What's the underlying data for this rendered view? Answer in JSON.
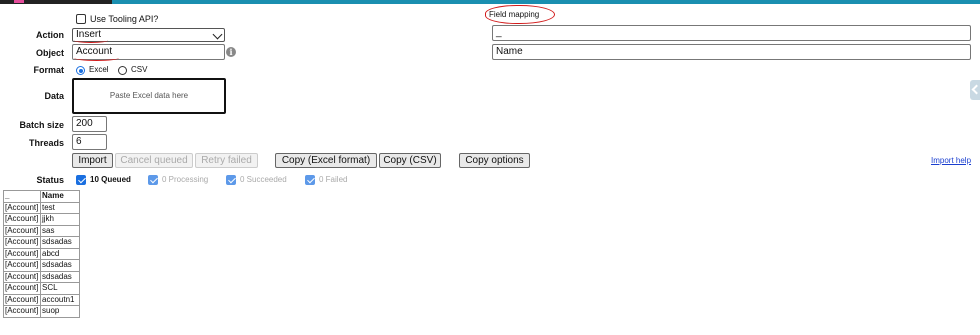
{
  "tooling_api": {
    "label": "Use Tooling API?",
    "checked": false
  },
  "field_mapping": {
    "title": "Field mapping",
    "mapping_1": "_",
    "mapping_2": "Name"
  },
  "form": {
    "action_label": "Action",
    "action_value": "Insert",
    "object_label": "Object",
    "object_value": "Account",
    "info_icon": "i",
    "format_label": "Format",
    "format_options": [
      "Excel",
      "CSV"
    ],
    "format_selected": "Excel",
    "data_label": "Data",
    "data_placeholder": "Paste Excel data here",
    "batch_label": "Batch size",
    "batch_value": "200",
    "threads_label": "Threads",
    "threads_value": "6"
  },
  "buttons": {
    "import": "Import",
    "cancel": "Cancel queued",
    "retry": "Retry failed",
    "copy_excel": "Copy (Excel format)",
    "copy_csv": "Copy (CSV)",
    "copy_options": "Copy options",
    "import_help": "Import help"
  },
  "status": {
    "label": "Status",
    "queued": "10 Queued",
    "processing": "0 Processing",
    "succeeded": "0 Succeeded",
    "failed": "0 Failed"
  },
  "results": {
    "headers": [
      "_",
      "Name"
    ],
    "rows": [
      [
        "[Account]",
        "test"
      ],
      [
        "[Account]",
        "jjkh"
      ],
      [
        "[Account]",
        "sas"
      ],
      [
        "[Account]",
        "sdsadas"
      ],
      [
        "[Account]",
        "abcd"
      ],
      [
        "[Account]",
        "sdsadas"
      ],
      [
        "[Account]",
        "sdsadas"
      ],
      [
        "[Account]",
        "SCL"
      ],
      [
        "[Account]",
        "accoutn1"
      ],
      [
        "[Account]",
        "suop"
      ]
    ]
  },
  "colors": {
    "accent": "#1a8fb0",
    "checkbox": "#1a6fe0",
    "annotation": "#d21b1b",
    "link": "#1a3fd0"
  },
  "icons": [
    "info-icon",
    "chevron-down-icon",
    "collapse-panel-icon",
    "checkbox-icon",
    "radio-icon"
  ]
}
